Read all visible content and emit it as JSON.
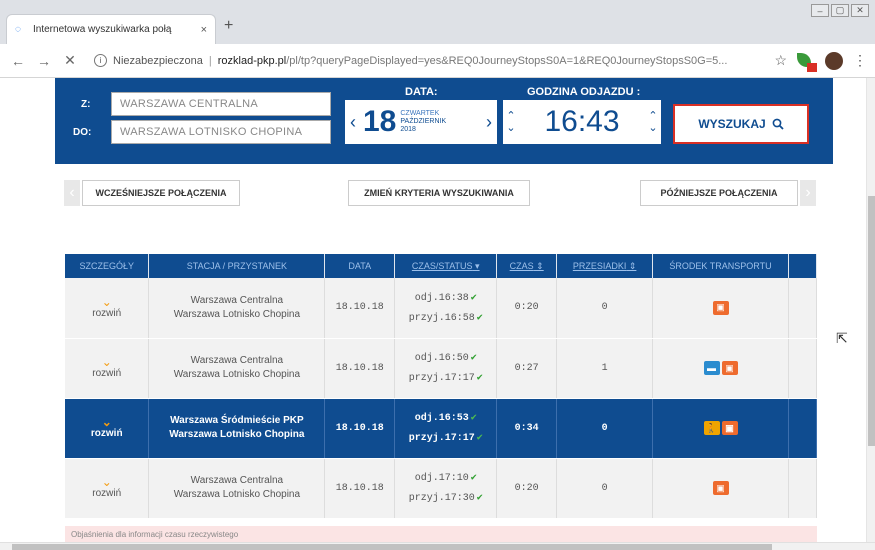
{
  "browser": {
    "tab_title": "Internetowa wyszukiwarka połą",
    "tab_close": "×",
    "new_tab": "+",
    "url_security": "Niezabezpieczona",
    "url_domain": "rozklad-pkp.pl",
    "url_path": "/pl/tp?queryPageDisplayed=yes&REQ0JourneyStopsS0A=1&REQ0JourneyStopsS0G=5..."
  },
  "search": {
    "from_label": "Z:",
    "to_label": "DO:",
    "from_value": "WARSZAWA CENTRALNA",
    "to_value": "WARSZAWA LOTNISKO CHOPINA",
    "date_header": "DATA:",
    "day": "18",
    "weekday": "CZWARTEK",
    "month": "PAŹDZIERNIK",
    "year": "2018",
    "time_header": "GODZINA ODJAZDU :",
    "time": "16:43",
    "search_button": "WYSZUKAJ"
  },
  "nav": {
    "earlier": "WCZEŚNIEJSZE POŁĄCZENIA",
    "change": "ZMIEŃ KRYTERIA WYSZUKIWANIA",
    "later": "PÓŹNIEJSZE POŁĄCZENIA"
  },
  "table": {
    "headers": [
      "SZCZEGÓŁY",
      "STACJA / PRZYSTANEK",
      "DATA",
      "CZAS/STATUS",
      "CZAS",
      "PRZESIADKI",
      "ŚRODEK TRANSPORTU"
    ],
    "rows": [
      {
        "expand": "rozwiń",
        "from": "Warszawa Centralna",
        "to": "Warszawa Lotnisko Chopina",
        "date": "18.10.18",
        "dep": "odj.16:38",
        "arr": "przyj.16:58",
        "duration": "0:20",
        "transfers": "0"
      },
      {
        "expand": "rozwiń",
        "from": "Warszawa Centralna",
        "to": "Warszawa Lotnisko Chopina",
        "date": "18.10.18",
        "dep": "odj.16:50",
        "arr": "przyj.17:17",
        "duration": "0:27",
        "transfers": "1"
      },
      {
        "expand": "rozwiń",
        "from": "Warszawa Śródmieście PKP",
        "to": "Warszawa Lotnisko Chopina",
        "date": "18.10.18",
        "dep": "odj.16:53",
        "arr": "przyj.17:17",
        "duration": "0:34",
        "transfers": "0"
      },
      {
        "expand": "rozwiń",
        "from": "Warszawa Centralna",
        "to": "Warszawa Lotnisko Chopina",
        "date": "18.10.18",
        "dep": "odj.17:10",
        "arr": "przyj.17:30",
        "duration": "0:20",
        "transfers": "0"
      }
    ]
  },
  "notice": "Objaśnienia dla informacji czasu rzeczywistego",
  "colors": {
    "brand": "#0f4c90",
    "accent": "#d93025",
    "chevron": "#f39c12",
    "train": "#ee6b2e"
  },
  "icons": [
    "search-icon",
    "chevron-down-icon",
    "train-icon",
    "tram-icon",
    "walk-icon",
    "check-icon"
  ]
}
